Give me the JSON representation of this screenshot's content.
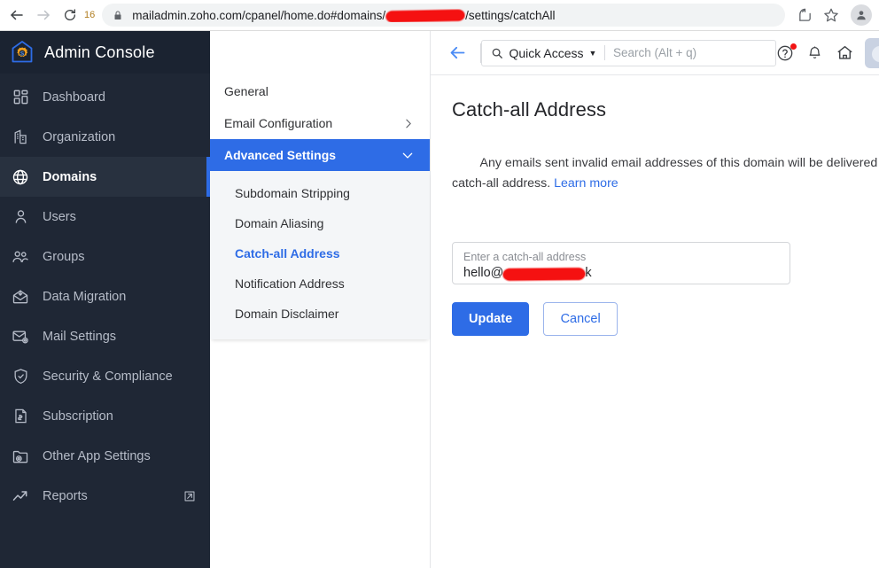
{
  "browser": {
    "reload_badge": "16",
    "url_prefix": "mailadmin.zoho.com/cpanel/home.do#domains/",
    "url_suffix": "/settings/catchAll",
    "url_redacted": true,
    "icons": {
      "back": "back-arrow-icon",
      "forward": "forward-arrow-icon",
      "reload": "reload-icon",
      "lock": "lock-icon",
      "share": "share-icon",
      "bookmark": "star-icon",
      "profile": "profile-avatar-icon"
    }
  },
  "sidebar": {
    "brand": "Admin Console",
    "brand_logo": "zoho-admin-house-gear-logo",
    "items": [
      {
        "label": "Dashboard",
        "icon": "dashboard-grid-icon",
        "active": false,
        "external": false
      },
      {
        "label": "Organization",
        "icon": "building-icon",
        "active": false,
        "external": false
      },
      {
        "label": "Domains",
        "icon": "globe-icon",
        "active": true,
        "external": false
      },
      {
        "label": "Users",
        "icon": "user-icon",
        "active": false,
        "external": false
      },
      {
        "label": "Groups",
        "icon": "users-group-icon",
        "active": false,
        "external": false
      },
      {
        "label": "Data Migration",
        "icon": "data-migration-icon",
        "active": false,
        "external": false
      },
      {
        "label": "Mail Settings",
        "icon": "mail-gear-icon",
        "active": false,
        "external": false
      },
      {
        "label": "Security & Compliance",
        "icon": "shield-check-icon",
        "active": false,
        "external": false
      },
      {
        "label": "Subscription",
        "icon": "invoice-icon",
        "active": false,
        "external": false
      },
      {
        "label": "Other App Settings",
        "icon": "folder-gear-icon",
        "active": false,
        "external": false
      },
      {
        "label": "Reports",
        "icon": "trend-arrow-icon",
        "active": false,
        "external": true
      }
    ]
  },
  "subnav": {
    "items": [
      {
        "label": "General",
        "type": "link"
      },
      {
        "label": "Email Configuration",
        "type": "accordion",
        "state": "collapsed",
        "icon": "chevron-right-icon"
      },
      {
        "label": "Advanced Settings",
        "type": "accordion",
        "state": "expanded",
        "icon": "chevron-down-icon"
      }
    ],
    "children": [
      {
        "label": "Subdomain Stripping",
        "active": false
      },
      {
        "label": "Domain Aliasing",
        "active": false
      },
      {
        "label": "Catch-all Address",
        "active": true
      },
      {
        "label": "Notification Address",
        "active": false
      },
      {
        "label": "Domain Disclaimer",
        "active": false
      }
    ]
  },
  "topbar": {
    "back_icon": "back-arrow-icon",
    "quick_access_label": "Quick Access",
    "quick_access_caret": "▼",
    "search_icon": "search-icon",
    "search_placeholder": "Search (Alt + q)",
    "search_value": "",
    "help_icon": "help-circle-icon",
    "help_has_badge": true,
    "bell_icon": "bell-icon",
    "home_icon": "home-icon",
    "avatar": "user-avatar"
  },
  "content": {
    "title": "Catch-all Address",
    "description": "Any emails sent invalid email addresses of this domain will be delivered to the catch-all address. ",
    "learn_more": "Learn more",
    "field": {
      "label": "Enter a catch-all address",
      "value_prefix": "hello@",
      "value_suffix": "k",
      "value_redacted": true
    },
    "buttons": {
      "primary": "Update",
      "secondary": "Cancel"
    }
  },
  "colors": {
    "sidebar_bg": "#1f2735",
    "sidebar_active_bg": "#28313f",
    "accent_blue": "#2e6ce6",
    "redaction_red": "#f51111",
    "subnav_child_bg": "#f4f6f8"
  }
}
